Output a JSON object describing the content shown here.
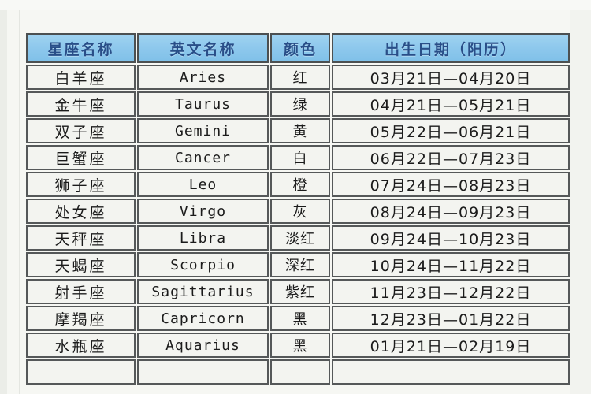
{
  "page": {
    "top_cut_text": "···· ······ · · ····",
    "background_color": "#f4f5f1",
    "header_accent_color": "#8cc6ea",
    "header_text_color": "#2b4f88",
    "border_color": "#56595a",
    "cell_background_color": "#f1f2ee"
  },
  "table": {
    "name": "zodiac-reference-table",
    "columns": [
      {
        "key": "name_cn",
        "label": "星座名称"
      },
      {
        "key": "name_en",
        "label": "英文名称"
      },
      {
        "key": "color",
        "label": "颜色"
      },
      {
        "key": "date",
        "label": "出生日期（阳历）"
      }
    ],
    "rows": [
      {
        "name_cn": "白羊座",
        "name_en": "Aries",
        "color": "红",
        "date": "03月21日—04月20日"
      },
      {
        "name_cn": "金牛座",
        "name_en": "Taurus",
        "color": "绿",
        "date": "04月21日—05月21日"
      },
      {
        "name_cn": "双子座",
        "name_en": "Gemini",
        "color": "黄",
        "date": "05月22日—06月21日"
      },
      {
        "name_cn": "巨蟹座",
        "name_en": "Cancer",
        "color": "白",
        "date": "06月22日—07月23日"
      },
      {
        "name_cn": "狮子座",
        "name_en": "Leo",
        "color": "橙",
        "date": "07月24日—08月23日"
      },
      {
        "name_cn": "处女座",
        "name_en": "Virgo",
        "color": "灰",
        "date": "08月24日—09月23日"
      },
      {
        "name_cn": "天秤座",
        "name_en": "Libra",
        "color": "淡红",
        "date": "09月24日—10月23日"
      },
      {
        "name_cn": "天蝎座",
        "name_en": "Scorpio",
        "color": "深红",
        "date": "10月24日—11月22日"
      },
      {
        "name_cn": "射手座",
        "name_en": "Sagittarius",
        "color": "紫红",
        "date": "11月23日—12月22日"
      },
      {
        "name_cn": "摩羯座",
        "name_en": "Capricorn",
        "color": "黑",
        "date": "12月23日—01月22日"
      },
      {
        "name_cn": "水瓶座",
        "name_en": "Aquarius",
        "color": "黑",
        "date": "01月21日—02月19日"
      },
      {
        "name_cn": "",
        "name_en": "",
        "color": "",
        "date": ""
      }
    ]
  }
}
